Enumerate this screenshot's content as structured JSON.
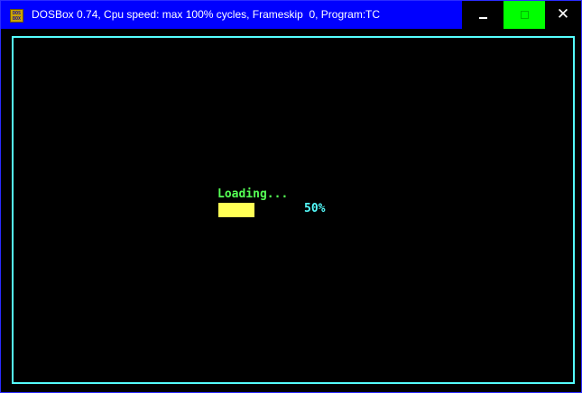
{
  "window": {
    "title": "DOSBox 0.74, Cpu speed: max 100% cycles, Frameskip  0, Program:",
    "program": "TC",
    "icon_text_top": "DOS",
    "icon_text_bottom": "BOX",
    "icons": {
      "app": "dosbox-app-icon",
      "minimize": "minimize-icon",
      "maximize": "maximize-icon",
      "close": "close-icon"
    },
    "close_glyph": "✕"
  },
  "dos_screen": {
    "loading_label": "Loading...",
    "progress": 0.5,
    "percent_label": "50%"
  },
  "colors": {
    "titlebar": "#0000ff",
    "maximize_button": "#00ff00",
    "border": "#55ffff",
    "loading_text": "#55ff55",
    "progress_fill": "#ffff55",
    "percent_text": "#55ffff"
  }
}
